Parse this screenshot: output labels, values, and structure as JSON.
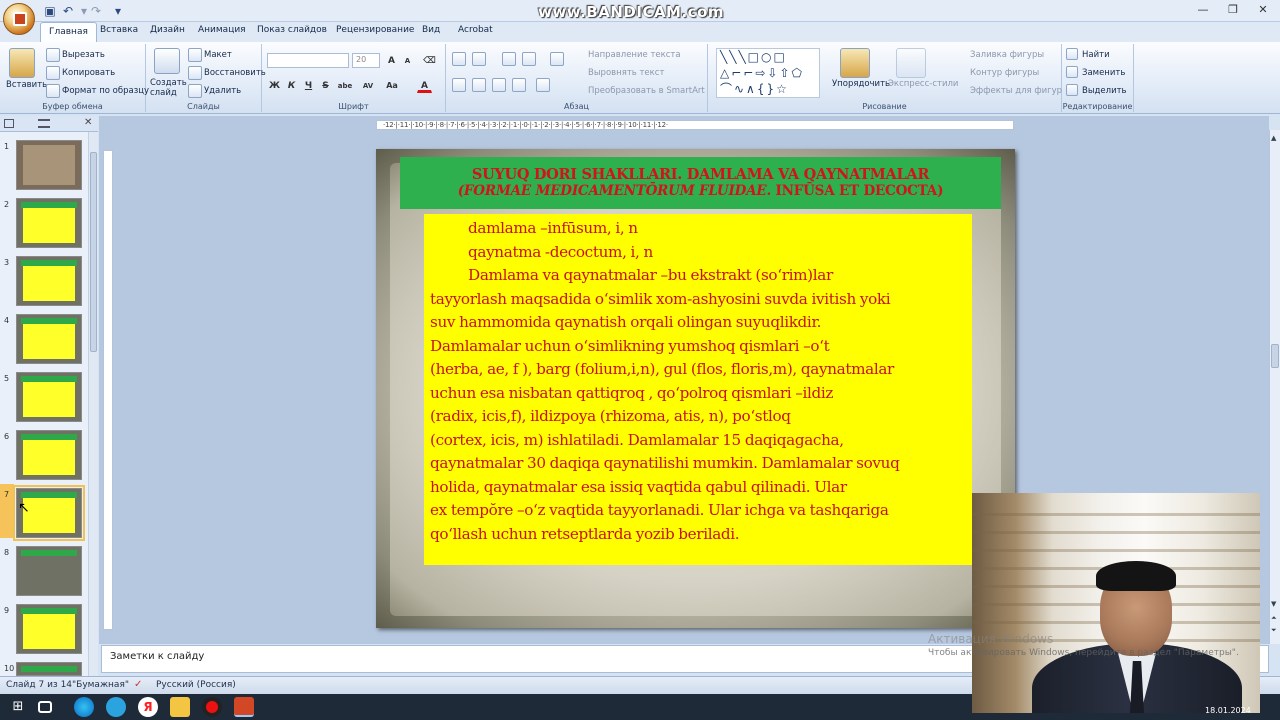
{
  "watermark": "www.BANDICAM.com",
  "tabs": [
    "Главная",
    "Вставка",
    "Дизайн",
    "Анимация",
    "Показ слайдов",
    "Рецензирование",
    "Вид",
    "Acrobat"
  ],
  "ribbon": {
    "clipboard": {
      "paste": "Вставить",
      "cut": "Вырезать",
      "copy": "Копировать",
      "format_painter": "Формат по образцу",
      "label": "Буфер обмена"
    },
    "slides": {
      "new_slide": "Создать слайд",
      "layout": "Макет",
      "reset": "Восстановить",
      "delete": "Удалить",
      "label": "Слайды"
    },
    "font": {
      "size": "20",
      "label": "Шрифт",
      "bold": "Ж",
      "italic": "К",
      "underline": "Ч",
      "strike": "S",
      "shadow": "abe",
      "spacing": "AV",
      "case": "Aa",
      "color": "A"
    },
    "paragraph": {
      "text_direction": "Направление текста",
      "align_text": "Выровнять текст",
      "smartart": "Преобразовать в SmartArt",
      "label": "Абзац"
    },
    "drawing": {
      "arrange": "Упорядочить",
      "quick_styles": "Экспресс-стили",
      "fill": "Заливка фигуры",
      "outline": "Контур фигуры",
      "effects": "Эффекты для фигур",
      "label": "Рисование"
    },
    "editing": {
      "find": "Найти",
      "replace": "Заменить",
      "select": "Выделить",
      "label": "Редактирование"
    }
  },
  "ruler_h": "·12·|·11·|·10·|·9·|·8·|·7·|·6·|·5·|·4·|·3·|·2·|·1·|·0·|·1·|·2·|·3·|·4·|·5·|·6·|·7·|·8·|·9·|·10·|·11·|·12·",
  "thumbnails": [
    "1",
    "2",
    "3",
    "4",
    "5",
    "6",
    "7",
    "8",
    "9",
    "10"
  ],
  "selected_slide": 7,
  "slide": {
    "title_line1": "SUYUQ DORI SHAKLLARI. DAMLAMA VA QAYNATMALAR",
    "title_line2_italic": "(FORMAE MEDICAMENTŌRUM FLUIDAE.",
    "title_line2_rest": " INFŪSA ET DECOCTA)",
    "lines": [
      "damlama –infūsum, i, n",
      "qaynatma  -decoctum,  i,  n",
      "Damlama va qaynatmalar –bu ekstrakt (so‘rim)lar",
      "tayyorlash maqsadida o‘simlik xom-ashyosini suvda ivitish yoki",
      "suv hammomida qaynatish orqali olingan suyuqlikdir.",
      "Damlamalar uchun o‘simlikning yumshoq qismlari –o‘t",
      "(herba, ae, f ), barg (folium,i,n), gul (flos, floris,m), qaynatmalar",
      "uchun esa nisbatan qattiqroq , qo‘polroq qismlari –ildiz",
      "(radix, icis,f), ildizpoya (rhizoma, atis, n), po‘stloq",
      "(cortex, icis, m) ishlatiladi.  Damlamalar 15 daqiqagacha,",
      "qaynatmalar 30 daqiqa qaynatilishi  mumkin.  Damlamalar sovuq",
      "holida, qaynatmalar esa issiq vaqtida qabul qilinadi.  Ular",
      "ex tempŏre –o‘z vaqtida tayyorlanadi.  Ular ichga va tashqariga",
      "qo‘llash uchun retseptlarda yozib beriladi."
    ]
  },
  "notes_placeholder": "Заметки к слайду",
  "status": {
    "slide_info": "Слайд 7 из 14",
    "theme": "\"Бумажная\"",
    "language": "Русский (Россия)"
  },
  "activation": {
    "line1": "Активация Windows",
    "line2": "Чтобы активировать Windows, перейдите в раздел \"Параметры\"."
  },
  "clock": "18.01.2024"
}
